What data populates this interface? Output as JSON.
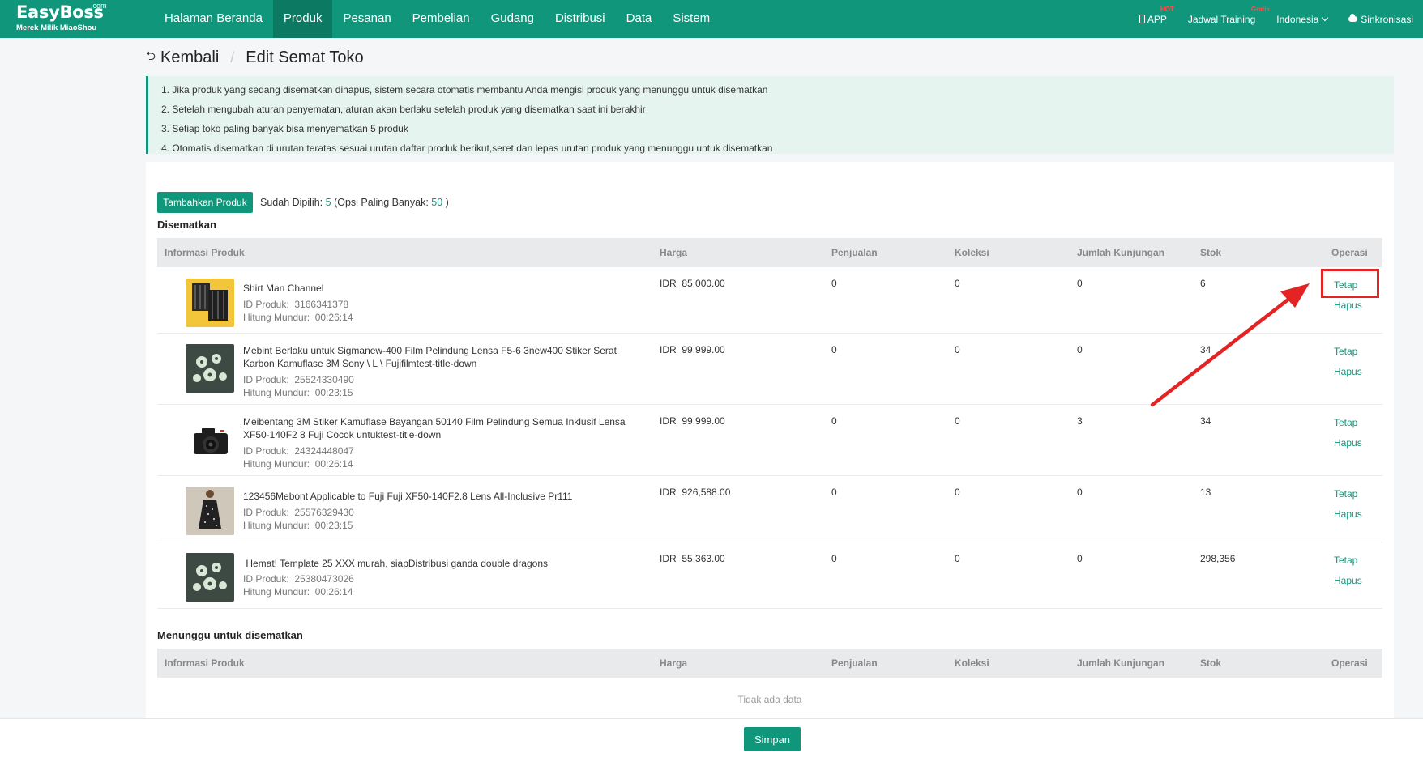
{
  "brand": {
    "name": "EasyBoss",
    "suffix": ".com",
    "tagline": "Merek Milik MiaoShou"
  },
  "nav": {
    "items": [
      "Halaman Beranda",
      "Produk",
      "Pesanan",
      "Pembelian",
      "Gudang",
      "Distribusi",
      "Data",
      "Sistem"
    ],
    "active": "Produk"
  },
  "nav_right": {
    "app": "APP",
    "app_badge": "HOT",
    "training": "Jadwal Training",
    "training_badge": "Gratis",
    "region": "Indonesia",
    "sync": "Sinkronisasi"
  },
  "header": {
    "back": "Kembali",
    "title": "Edit Semat Toko"
  },
  "notice": [
    "1. Jika produk yang sedang disematkan dihapus, sistem secara otomatis membantu Anda mengisi produk yang menunggu untuk disematkan",
    "2. Setelah mengubah aturan penyematan, aturan akan berlaku setelah produk yang disematkan saat ini berakhir",
    "3. Setiap toko paling banyak bisa menyematkan 5 produk",
    "4. Otomatis disematkan di urutan teratas sesuai urutan daftar produk berikut,seret dan lepas urutan produk yang menunggu untuk disematkan"
  ],
  "toolbar": {
    "add_button": "Tambahkan Produk",
    "selected_label": "Sudah Dipilih:",
    "selected_count": "5",
    "max_label": "(Opsi Paling Banyak:",
    "max_count": "50",
    "max_close": ")"
  },
  "pinned": {
    "title": "Disematkan"
  },
  "waiting": {
    "title": "Menunggu untuk disematkan",
    "empty": "Tidak ada data"
  },
  "columns": {
    "info": "Informasi Produk",
    "price": "Harga",
    "sales": "Penjualan",
    "collection": "Koleksi",
    "visits": "Jumlah Kunjungan",
    "stock": "Stok",
    "operation": "Operasi"
  },
  "labels": {
    "id": "ID Produk:",
    "countdown": "Hitung Mundur:",
    "currency": "IDR",
    "op_fix": "Tetap",
    "op_delete": "Hapus"
  },
  "products": [
    {
      "name": "Shirt Man Channel",
      "id": "3166341378",
      "countdown": "00:26:14",
      "price": "85,000.00",
      "sales": "0",
      "collection": "0",
      "visits": "0",
      "stock": "6",
      "thumb": "shirt"
    },
    {
      "name": "Mebint Berlaku untuk Sigmanew-400 Film Pelindung Lensa F5-6 3new400 Stiker Serat Karbon Kamuflase 3M Sony \\ L \\ Fujifilmtest-title-down",
      "id": "25524330490",
      "countdown": "00:23:15",
      "price": "99,999.00",
      "sales": "0",
      "collection": "0",
      "visits": "0",
      "stock": "34",
      "thumb": "flower"
    },
    {
      "name": "Meibentang 3M Stiker Kamuflase Bayangan 50140 Film Pelindung Semua Inklusif Lensa XF50-140F2 8 Fuji Cocok untuktest-title-down",
      "id": "24324448047",
      "countdown": "00:26:14",
      "price": "99,999.00",
      "sales": "0",
      "collection": "0",
      "visits": "3",
      "stock": "34",
      "thumb": "camera"
    },
    {
      "name": "123456Mebont Applicable to Fuji Fuji XF50-140F2.8 Lens All-Inclusive Pr111",
      "id": "25576329430",
      "countdown": "00:23:15",
      "price": "926,588.00",
      "sales": "0",
      "collection": "0",
      "visits": "0",
      "stock": "13",
      "thumb": "dress"
    },
    {
      "name": " Hemat! Template 25 XXX murah, siapDistribusi ganda double dragons",
      "id": "25380473026",
      "countdown": "00:26:14",
      "price": "55,363.00",
      "sales": "0",
      "collection": "0",
      "visits": "0",
      "stock": "298,356",
      "thumb": "flower"
    }
  ],
  "footer": {
    "save": "Simpan"
  },
  "colors": {
    "primary": "#10967b",
    "nav_active": "#0c7a63",
    "annotation": "#e42424",
    "notice_bg": "#e6f4ef"
  }
}
